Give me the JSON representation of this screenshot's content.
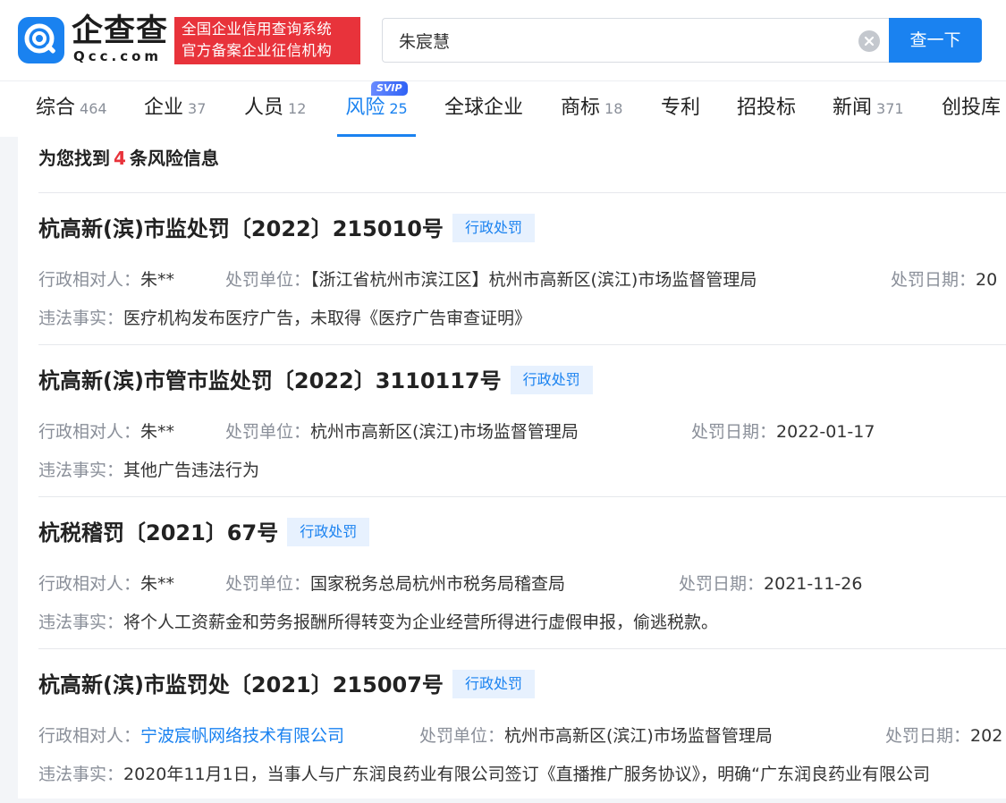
{
  "header": {
    "logo_name": "企查查",
    "logo_domain": "Qcc.com",
    "badge_line1": "全国企业信用查询系统",
    "badge_line2": "官方备案企业征信机构",
    "search_value": "朱宸慧",
    "search_button": "查一下"
  },
  "tabs": [
    {
      "label": "综合",
      "count": "464"
    },
    {
      "label": "企业",
      "count": "37"
    },
    {
      "label": "人员",
      "count": "12"
    },
    {
      "label": "风险",
      "count": "25",
      "active": true,
      "badge": "SVIP"
    },
    {
      "label": "全球企业",
      "count": ""
    },
    {
      "label": "商标",
      "count": "18"
    },
    {
      "label": "专利",
      "count": ""
    },
    {
      "label": "招投标",
      "count": ""
    },
    {
      "label": "新闻",
      "count": "371"
    },
    {
      "label": "创投库",
      "count": ""
    }
  ],
  "results": {
    "summary_prefix": "为您找到",
    "summary_count": "4",
    "summary_suffix": "条风险信息",
    "items": [
      {
        "title": "杭高新(滨)市监处罚〔2022〕215010号",
        "tag": "行政处罚",
        "party_label": "行政相对人：",
        "party_value": "朱**",
        "unit_label": "处罚单位：",
        "unit_value": "【浙江省杭州市滨江区】杭州市高新区(滨江)市场监督管理局",
        "date_label": "处罚日期：",
        "date_value": "20",
        "fact_label": "违法事实：",
        "fact_value": "医疗机构发布医疗广告，未取得《医疗广告审查证明》"
      },
      {
        "title": "杭高新(滨)市管市监处罚〔2022〕3110117号",
        "tag": "行政处罚",
        "party_label": "行政相对人：",
        "party_value": "朱**",
        "unit_label": "处罚单位：",
        "unit_value": "杭州市高新区(滨江)市场监督管理局",
        "date_label": "处罚日期：",
        "date_value": "2022-01-17",
        "fact_label": "违法事实：",
        "fact_value": "其他广告违法行为"
      },
      {
        "title": "杭税稽罚〔2021〕67号",
        "tag": "行政处罚",
        "party_label": "行政相对人：",
        "party_value": "朱**",
        "unit_label": "处罚单位：",
        "unit_value": "国家税务总局杭州市税务局稽查局",
        "date_label": "处罚日期：",
        "date_value": "2021-11-26",
        "fact_label": "违法事实：",
        "fact_value": "将个人工资薪金和劳务报酬所得转变为企业经营所得进行虚假申报，偷逃税款。"
      },
      {
        "title": "杭高新(滨)市监罚处〔2021〕215007号",
        "tag": "行政处罚",
        "party_label": "行政相对人：",
        "party_value": "宁波宸帆网络技术有限公司",
        "unit_label": "处罚单位：",
        "unit_value": "杭州市高新区(滨江)市场监督管理局",
        "date_label": "处罚日期：",
        "date_value": "202",
        "fact_label": "违法事实：",
        "fact_value": "2020年11月1日，当事人与广东润良药业有限公司签订《直播推广服务协议》，明确“广东润良药业有限公司"
      }
    ]
  },
  "colors": {
    "brand_blue": "#1a82f0",
    "brand_red": "#e8333b",
    "tag_bg": "#e7f1fe",
    "label_gray": "#8a8f99"
  },
  "icons": {
    "logo": "qcc-logo-icon",
    "clear": "clear-circle-icon"
  }
}
